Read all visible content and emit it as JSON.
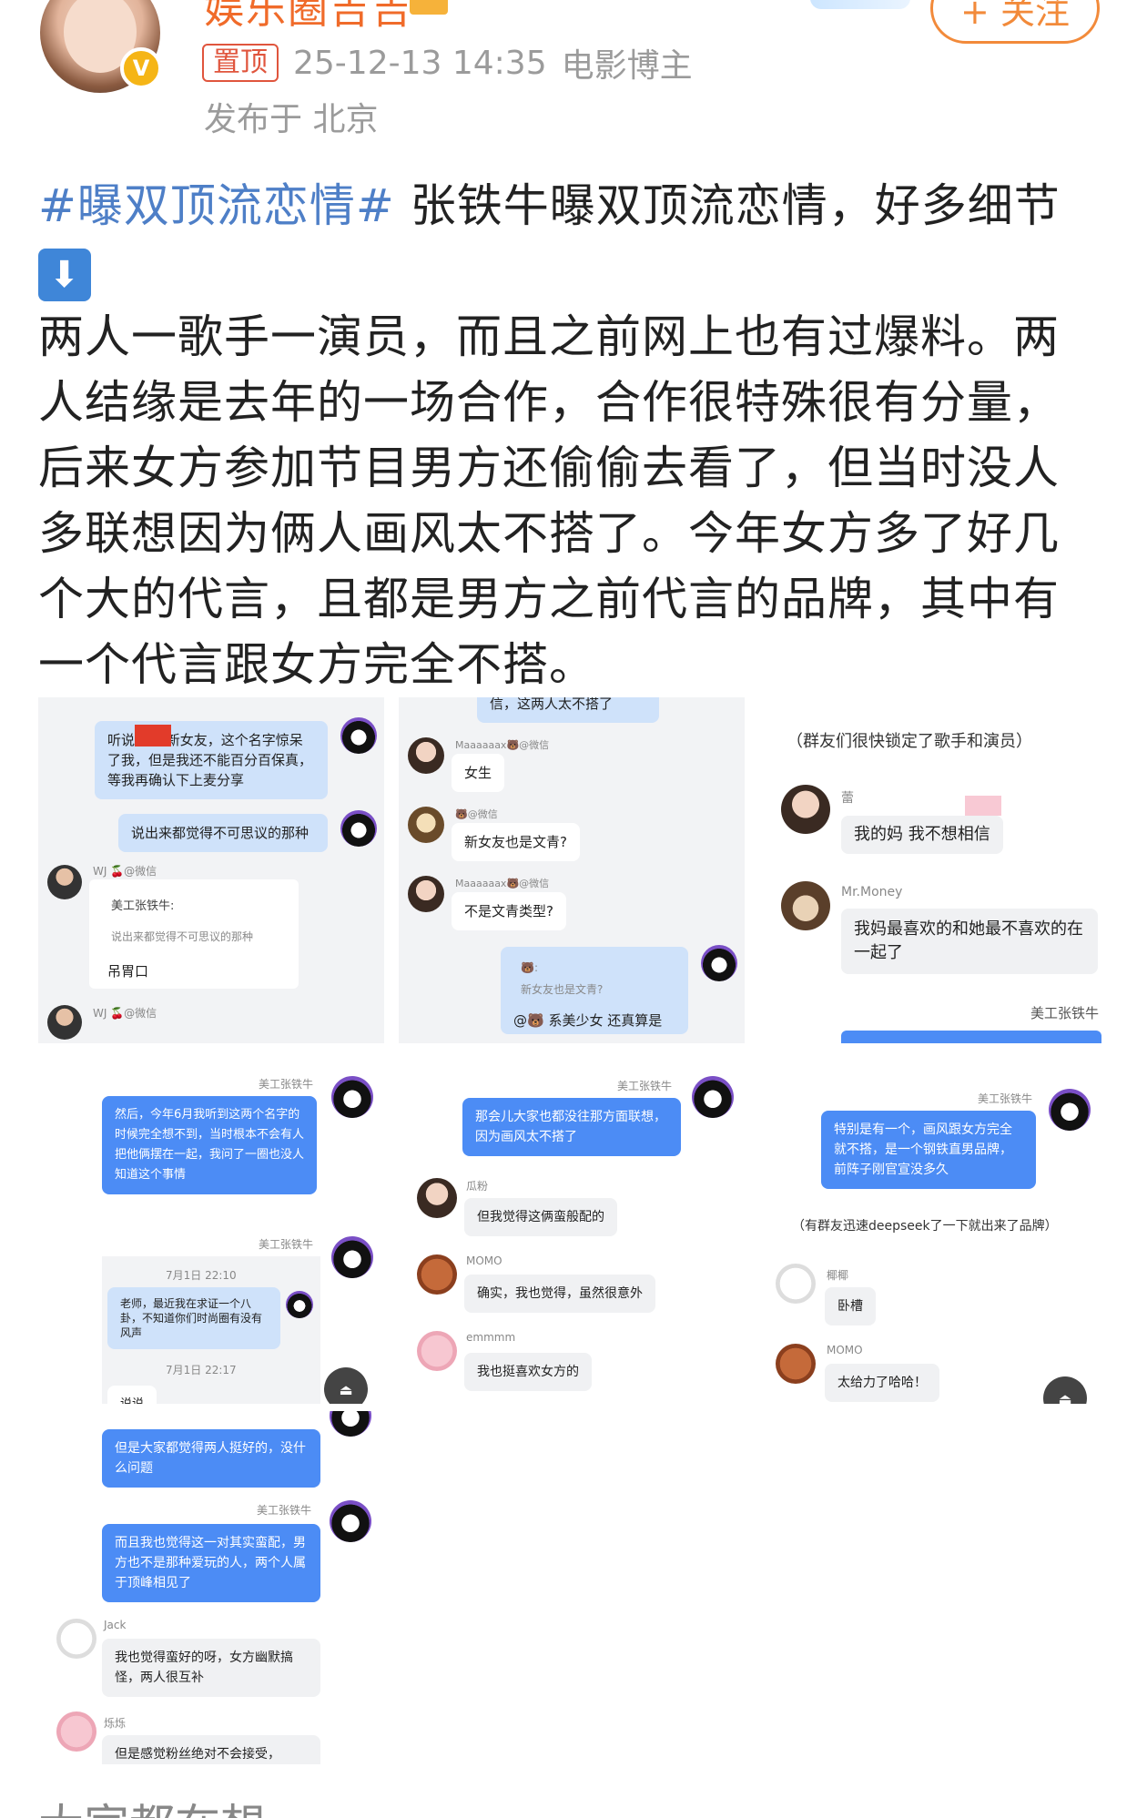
{
  "header": {
    "username": "娱乐圈吉吉",
    "pin_label": "置顶",
    "timestamp": "25-12-13 14:35",
    "user_tag": "电影博主",
    "location": "发布于 北京",
    "follow_label": "+ 关注",
    "verified_mark": "V"
  },
  "post": {
    "hashtag": "#曝双顶流恋情#",
    "line1": "张铁牛曝双顶流恋情，好多细节",
    "arrow": "⬇",
    "line2": "两人一歌手一演员，而且之前网上也有过爆料。两",
    "line3": "人结缘是去年的一场合作，合作很特殊很有分量，",
    "line4": "后来女方参加节目男方还偷偷去看了，但当时没人",
    "line5": "多联想因为俩人画风太不搭了。今年女方多了好几",
    "line6": "个大的代言，且都是男方之前代言的品牌，其中有",
    "line7": "一个代言跟女方完全不搭。"
  },
  "shot1": {
    "b1": "听说 有个新女友，这个名字惊呆了我，但是我还不能百分百保真，等我再确认下上麦分享",
    "b2": "说出来都觉得不可思议的那种",
    "user_wj": "WJ 🍒@微信",
    "quote_name": "美工张铁牛:",
    "quote_text": "说出来都觉得不可思议的那种",
    "reply": "吊胃口",
    "user_wj2": "WJ 🍒@微信"
  },
  "shot2": {
    "top": "信，这两人太不搭了",
    "u1": "Maaaaaax🐻@微信",
    "m1": "女生",
    "u2": "🐻@微信",
    "m2": "新女友也是文青?",
    "u3": "Maaaaaax🐻@微信",
    "m3": "不是文青类型?",
    "q_name": "🐻:",
    "q_text": "新女友也是文青?",
    "reply": "@🐻 系美少女 还真算是"
  },
  "shot3": {
    "note": "（群友们很快锁定了歌手和演员）",
    "u1": "蕾",
    "m1": "我的妈 我不想相信",
    "u2": "Mr.Money",
    "m2": "我妈最喜欢的和她最不喜欢的在一起了",
    "u3": "美工张铁牛"
  },
  "shot4": {
    "u1": "美工张铁牛",
    "m1": "然后，今年6月我听到这两个名字的时候完全想不到，当时根本不会有人把他俩摆在一起，我问了一圈也没人知道这个事情",
    "u2": "美工张铁牛",
    "t1": "7月1日 22:10",
    "q1": "老师，最近我在求证一个八卦，不知道你们时尚圈有没有风声",
    "t2": "7月1日 22:17",
    "q2": "说说",
    "fab": "⏏"
  },
  "shot5": {
    "u1": "美工张铁牛",
    "m1": "那会儿大家也都没往那方面联想，因为画风太不搭了",
    "u2": "瓜粉",
    "m2": "但我觉得这俩蛮般配的",
    "u3": "MOMO",
    "m3": "确实，我也觉得，虽然很意外",
    "u4": "emmmm",
    "m4": "我也挺喜欢女方的"
  },
  "shot6": {
    "u1": "美工张铁牛",
    "m1": "特别是有一个，画风跟女方完全就不搭，是一个钢铁直男品牌，前阵子刚官宣没多久",
    "note": "（有群友迅速deepseek了一下就出来了品牌）",
    "u2": "椰椰",
    "m2": "卧槽",
    "u3": "MOMO",
    "m3": "太给力了哈哈！",
    "fab": "⏏"
  },
  "shot7": {
    "m1": "但是大家都觉得两人挺好的，没什么问题",
    "u1": "美工张铁牛",
    "m2": "而且我也觉得这一对其实蛮配，男方也不是那种爱玩的人，两个人属于顶峰相见了",
    "u2": "Jack",
    "m3": "我也觉得蛮好的呀，女方幽默搞怪，两人很互补",
    "u3": "烁烁",
    "m4": "但是感觉粉丝绝对不会接受，"
  },
  "trailing": "大家都在想"
}
